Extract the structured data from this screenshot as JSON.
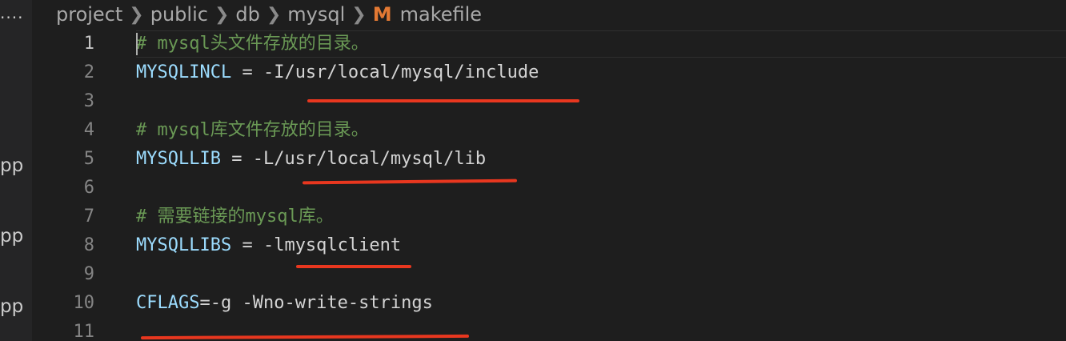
{
  "sidebar": {
    "more": "....",
    "fragments": [
      "pp",
      "pp",
      "pp"
    ]
  },
  "breadcrumb": {
    "items": [
      "project",
      "public",
      "db",
      "mysql"
    ],
    "file_icon": "M",
    "file_name": "makefile"
  },
  "editor": {
    "lines": [
      {
        "num": "1",
        "tokens": [
          {
            "t": "cmt",
            "v": "# mysql头文件存放的目录。"
          }
        ]
      },
      {
        "num": "2",
        "tokens": [
          {
            "t": "var",
            "v": "MYSQLINCL"
          },
          {
            "t": "plain",
            "v": " = -I/usr/local/mysql/include"
          }
        ]
      },
      {
        "num": "3",
        "tokens": []
      },
      {
        "num": "4",
        "tokens": [
          {
            "t": "cmt",
            "v": "# mysql库文件存放的目录。"
          }
        ]
      },
      {
        "num": "5",
        "tokens": [
          {
            "t": "var",
            "v": "MYSQLLIB"
          },
          {
            "t": "plain",
            "v": " = -L/usr/local/mysql/lib"
          }
        ]
      },
      {
        "num": "6",
        "tokens": []
      },
      {
        "num": "7",
        "tokens": [
          {
            "t": "cmt",
            "v": "# 需要链接的mysql库。"
          }
        ]
      },
      {
        "num": "8",
        "tokens": [
          {
            "t": "var",
            "v": "MYSQLLIBS"
          },
          {
            "t": "plain",
            "v": " = -lmysqlclient"
          }
        ]
      },
      {
        "num": "9",
        "tokens": []
      },
      {
        "num": "10",
        "tokens": [
          {
            "t": "var",
            "v": "CFLAGS"
          },
          {
            "t": "plain",
            "v": "=-g -Wno-write-strings"
          }
        ]
      },
      {
        "num": "11",
        "tokens": []
      }
    ]
  },
  "colors": {
    "background": "#1e1e1e",
    "comment": "#6a9955",
    "variable": "#9cdcfe",
    "annotation": "#e8371f",
    "makefile_icon": "#e37933"
  }
}
